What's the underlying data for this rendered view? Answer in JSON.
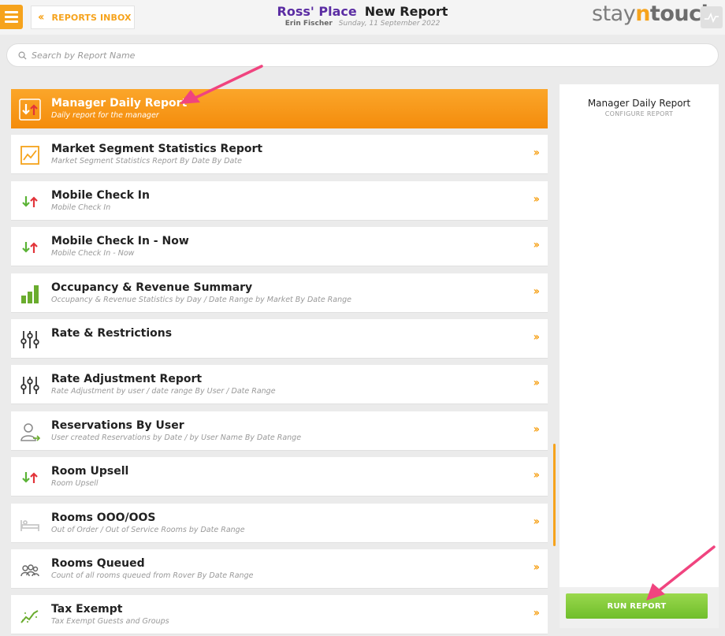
{
  "header": {
    "inbox_label": "REPORTS INBOX",
    "hotel_name": "Ross' Place",
    "page_title": "New Report",
    "user_name": "Erin Fischer",
    "date": "Sunday, 11 September 2022",
    "logo_stay": "stay",
    "logo_n": "n",
    "logo_touch": "touch"
  },
  "search": {
    "placeholder": "Search by Report Name"
  },
  "reports": [
    {
      "title": "Manager Daily Report",
      "desc": "Daily report for the manager",
      "icon": "arrows-icon",
      "active": true
    },
    {
      "title": "Market Segment Statistics Report",
      "desc": "Market Segment Statistics Report By Date By Date",
      "icon": "line-chart-icon"
    },
    {
      "title": "Mobile Check In",
      "desc": "Mobile Check In",
      "icon": "arrows-icon"
    },
    {
      "title": "Mobile Check In - Now",
      "desc": "Mobile Check In - Now",
      "icon": "arrows-icon"
    },
    {
      "title": "Occupancy & Revenue Summary",
      "desc": "Occupancy & Revenue Statistics by Day / Date Range by Market By Date Range",
      "icon": "bar-chart-icon"
    },
    {
      "title": "Rate & Restrictions",
      "desc": "",
      "icon": "sliders-icon"
    },
    {
      "title": "Rate Adjustment Report",
      "desc": "Rate Adjustment by user / date range By User / Date Range",
      "icon": "sliders-icon"
    },
    {
      "title": "Reservations By User",
      "desc": "User created Reservations by Date / by User Name By Date Range",
      "icon": "user-icon"
    },
    {
      "title": "Room Upsell",
      "desc": "Room Upsell",
      "icon": "arrows-icon"
    },
    {
      "title": "Rooms OOO/OOS",
      "desc": "Out of Order / Out of Service Rooms by Date Range",
      "icon": "bed-icon"
    },
    {
      "title": "Rooms Queued",
      "desc": "Count of all rooms queued from Rover By Date Range",
      "icon": "people-icon"
    },
    {
      "title": "Tax Exempt",
      "desc": "Tax Exempt Guests and Groups",
      "icon": "trend-icon"
    }
  ],
  "panel": {
    "title": "Manager Daily Report",
    "subtitle": "CONFIGURE REPORT",
    "run_label": "RUN REPORT"
  },
  "colors": {
    "accent": "#f6a31c",
    "brand_purple": "#5b2da3",
    "run_green": "#7ec636",
    "annotation": "#f0447f"
  }
}
